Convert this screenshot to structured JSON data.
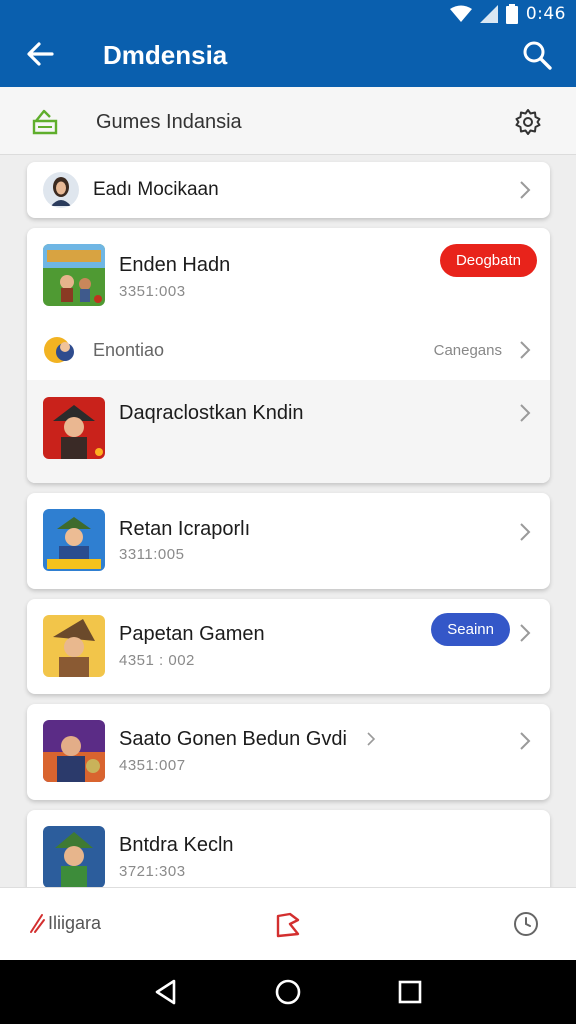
{
  "status": {
    "time": "0:46"
  },
  "appbar": {
    "title": "Dmdensia"
  },
  "subheader": {
    "title": "Gumes Indansia"
  },
  "items": [
    {
      "name": "Eadı Mocikaan"
    },
    {
      "name": "Enden Hadn",
      "sub": "3351:003",
      "badge": "Deogbatn"
    },
    {
      "name": "Enontiao",
      "right_label": "Canegans"
    },
    {
      "name": "Daqraclostkan Kndin"
    },
    {
      "name": "Retan Icraporlı",
      "sub": "3311:005"
    },
    {
      "name": "Papetan Gamen",
      "sub": "4351 : 002",
      "badge": "Seainn"
    },
    {
      "name": "Saato Gonen Bedun Gvdi",
      "sub": "4351:007"
    },
    {
      "name": "Bntdra Kecln",
      "sub": "3721:303"
    }
  ],
  "bottomnav": {
    "left_label": "Iliigara"
  },
  "colors": {
    "appbar": "#0a5fae",
    "badge_red": "#e8231b",
    "badge_blue": "#3457c8",
    "accent_green": "#5fae2c"
  }
}
